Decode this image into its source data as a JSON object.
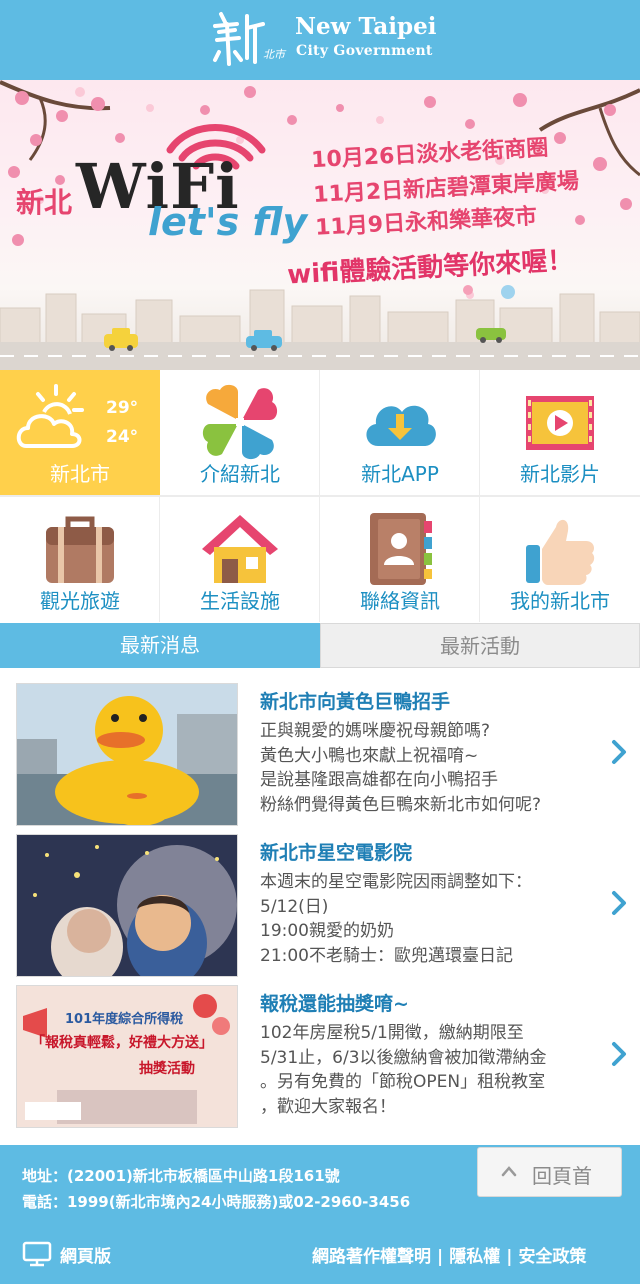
{
  "header": {
    "logo_cn": "新北市",
    "logo_title": "New Taipei",
    "logo_subtitle": "City Government"
  },
  "banner": {
    "brand_prefix": "新北",
    "brand_wifi": "WiFi",
    "brand_tagline": "let's fly",
    "events": [
      "10月26日淡水老街商圈",
      "11月2日新店碧潭東岸廣場",
      "11月9日永和樂華夜市"
    ],
    "slogan": "wifi體驗活動等你來喔！"
  },
  "weather": {
    "high": "29°",
    "low": "24°",
    "city": "新北市",
    "icon": "partly-cloudy-icon"
  },
  "menu_row1": [
    {
      "label": "介紹新北",
      "icon": "clover-heart-icon"
    },
    {
      "label": "新北APP",
      "icon": "cloud-download-icon"
    },
    {
      "label": "新北影片",
      "icon": "film-play-icon"
    }
  ],
  "menu_row2": [
    {
      "label": "觀光旅遊",
      "icon": "suitcase-icon"
    },
    {
      "label": "生活設施",
      "icon": "house-icon"
    },
    {
      "label": "聯絡資訊",
      "icon": "address-book-icon"
    },
    {
      "label": "我的新北市",
      "icon": "thumbs-up-icon"
    }
  ],
  "tabs": [
    {
      "label": "最新消息",
      "active": true
    },
    {
      "label": "最新活動",
      "active": false
    }
  ],
  "news": [
    {
      "title": "新北市向黃色巨鴨招手",
      "lines": [
        "正與親愛的媽咪慶祝母親節嗎?",
        "黃色大小鴨也來獻上祝福唷~",
        "是說基隆跟高雄都在向小鴨招手",
        "粉絲們覺得黃色巨鴨來新北市如何呢?"
      ]
    },
    {
      "title": "新北市星空電影院",
      "lines": [
        "本週末的星空電影院因雨調整如下：",
        "5/12(日)",
        "19:00親愛的奶奶",
        "21:00不老騎士：歐兜邁環臺日記"
      ]
    },
    {
      "title": "報稅還能抽獎唷~",
      "lines": [
        "102年房屋稅5/1開徵，繳納期限至",
        "5/31止，6/3以後繳納會被加徵滯納金",
        "。另有免費的「節稅OPEN」租稅教室",
        "，歡迎大家報名！"
      ],
      "thumb_text": {
        "title": "101年度綜合所得稅",
        "line1": "「報稅真輕鬆，好禮大方送」",
        "line2": "抽獎活動"
      }
    }
  ],
  "footer": {
    "address": "地址：(22001)新北市板橋區中山路1段161號",
    "phone": "電話：1999(新北市境內24小時服務)或02-2960-3456",
    "back_to_top": "回頁首",
    "web_version": "網頁版",
    "links": [
      "網路著作權聲明",
      "隱私權",
      "安全政策"
    ],
    "link_separator": "|"
  },
  "colors": {
    "accent": "#5ebbe3",
    "weather_bg": "#ffd04b",
    "link_blue": "#1c8fc2",
    "banner_pink": "#e6456f"
  }
}
